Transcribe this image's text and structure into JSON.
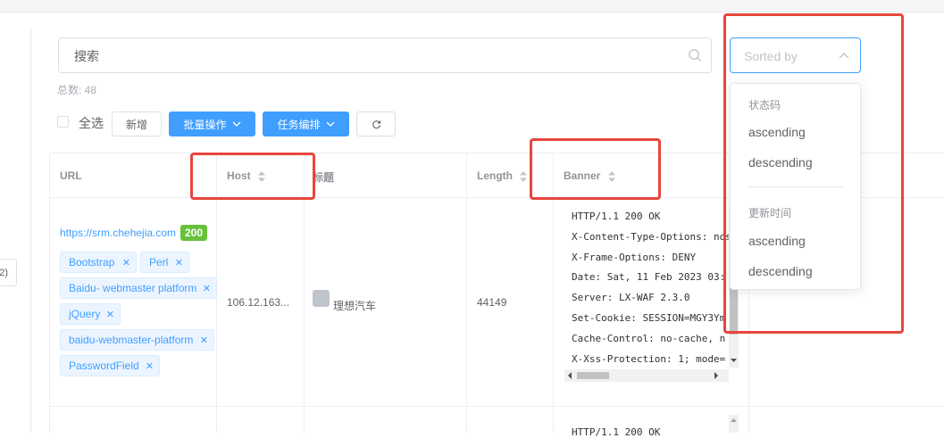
{
  "search": {
    "placeholder": "搜索"
  },
  "sort": {
    "placeholder": "Sorted by"
  },
  "total": "总数: 48",
  "toolbar": {
    "select_all": "全选",
    "add": "新增",
    "batch": "批量操作",
    "task": "任务编排"
  },
  "pager": {
    "label": "2)"
  },
  "table": {
    "headers": {
      "url": "URL",
      "host": "Host",
      "title": "标题",
      "length": "Length",
      "banner": "Banner"
    },
    "rows": [
      {
        "url": "https://srm.chehejia.com",
        "status": "200",
        "tags": [
          "Bootstrap",
          "Perl",
          "Baidu- webmaster platform",
          "jQuery",
          "baidu-webmaster-platform",
          "PasswordField"
        ],
        "host": "106.12.163...",
        "title": "理想汽车",
        "length": "44149",
        "banner": [
          "HTTP/1.1 200 OK",
          "X-Content-Type-Options: nosniff",
          "X-Frame-Options: DENY",
          "Date: Sat, 11 Feb 2023 03:",
          "Server: LX-WAF 2.3.0",
          "Set-Cookie: SESSION=MGY3Ym",
          "Cache-Control: no-cache, n",
          "X-Xss-Protection: 1; mode="
        ]
      },
      {
        "banner_first": "HTTP/1.1 200 OK"
      }
    ]
  },
  "dropdown": {
    "groups": [
      {
        "label": "状态码",
        "options": [
          "ascending",
          "descending"
        ]
      },
      {
        "label": "更新时间",
        "options": [
          "ascending",
          "descending"
        ]
      }
    ]
  },
  "colors": {
    "primary": "#409eff",
    "success": "#67c23a",
    "highlight": "#e8453c"
  }
}
